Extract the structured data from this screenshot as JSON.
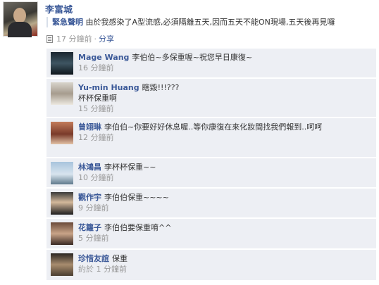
{
  "post": {
    "author": "李富城",
    "tag": "緊急聲明",
    "message": "由於我感染了A型流感,必須隔離五天,因而五天不能ON現場,五天後再見囉",
    "time": "17 分鐘前",
    "separator": "·",
    "share": "分享"
  },
  "comments": [
    {
      "name": "Mage Wang",
      "text": "李伯伯~多保重喔~祝您早日康復~",
      "time": "16 分鐘前"
    },
    {
      "name": "Yu-min Huang",
      "text": "瞎毀!!!???\n杯杯保重啊",
      "time": "15 分鐘前"
    },
    {
      "name": "曾翊琳",
      "text": "李伯伯~你要好好休息喔..等你康復在來化妝間找我們報到..呵呵",
      "time": "12 分鐘前"
    },
    {
      "name": "林鴻昌",
      "text": "李杯杯保重~~",
      "time": "10 分鐘前"
    },
    {
      "name": "觀作宇",
      "text": "李伯伯保重~~~~",
      "time": "9 分鐘前"
    },
    {
      "name": "花籮子",
      "text": "李伯伯要保重唷^^",
      "time": "5 分鐘前"
    },
    {
      "name": "珍惜友誼",
      "text": "保重",
      "time": "約於 1 分鐘前"
    }
  ],
  "colors": {
    "link": "#3b5998",
    "comment_bg": "#edeff4",
    "meta": "#999999"
  }
}
